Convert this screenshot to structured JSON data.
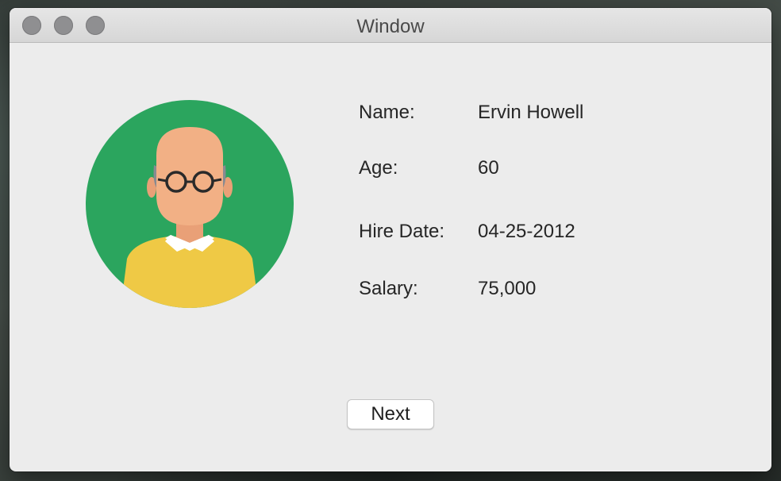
{
  "window": {
    "title": "Window"
  },
  "avatar": {
    "icon": "person-avatar-icon",
    "colors": {
      "background": "#2ba55e",
      "skin": "#f2b085",
      "sweater": "#efc945",
      "collar": "#ffffff",
      "hair": "#888a91",
      "glasses": "#2a2a2a"
    }
  },
  "details": {
    "name_label": "Name:",
    "name_value": "Ervin Howell",
    "age_label": "Age:",
    "age_value": "60",
    "hire_date_label": "Hire Date:",
    "hire_date_value": "04-25-2012",
    "salary_label": "Salary:",
    "salary_value": "75,000"
  },
  "actions": {
    "next_label": "Next"
  }
}
